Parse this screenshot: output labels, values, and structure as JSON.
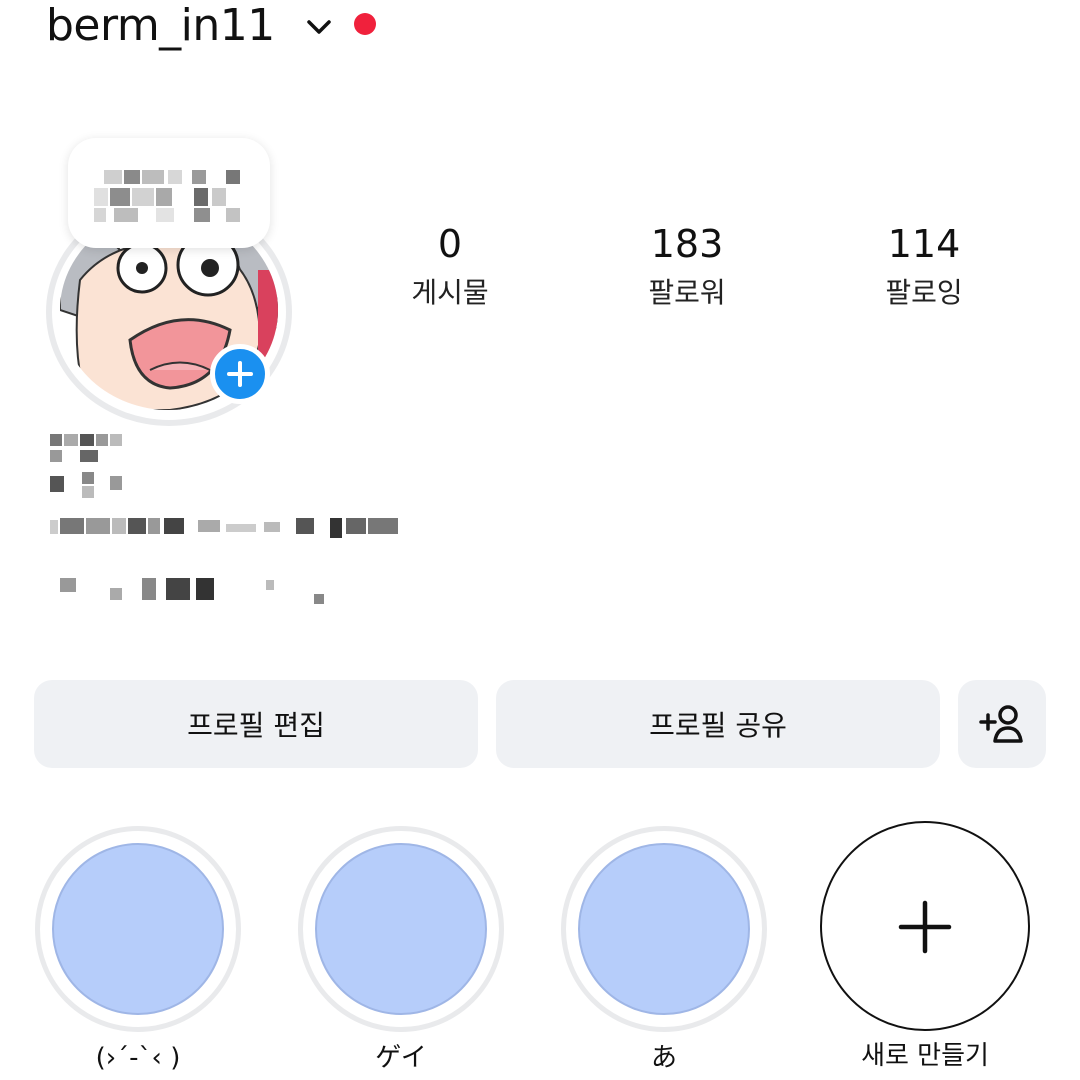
{
  "header": {
    "username": "berm_in11",
    "chevron_icon": "chevron-down-icon",
    "notification_dot_color": "#f0213c"
  },
  "stats": {
    "posts": {
      "value": "0",
      "label": "게시물"
    },
    "followers": {
      "value": "183",
      "label": "팔로워"
    },
    "following": {
      "value": "114",
      "label": "팔로잉"
    }
  },
  "buttons": {
    "edit_profile": "프로필 편집",
    "share_profile": "프로필 공유",
    "add_person_icon": "add-person-icon"
  },
  "highlights": [
    {
      "label": "(›´-`‹ )"
    },
    {
      "label": "ゲイ"
    },
    {
      "label": "あ"
    }
  ],
  "new_highlight": {
    "label": "새로 만들기",
    "icon": "plus-icon"
  },
  "colors": {
    "accent_blue": "#1a90f0",
    "button_bg": "#eff1f4",
    "highlight_fill": "#b6cdfa"
  }
}
